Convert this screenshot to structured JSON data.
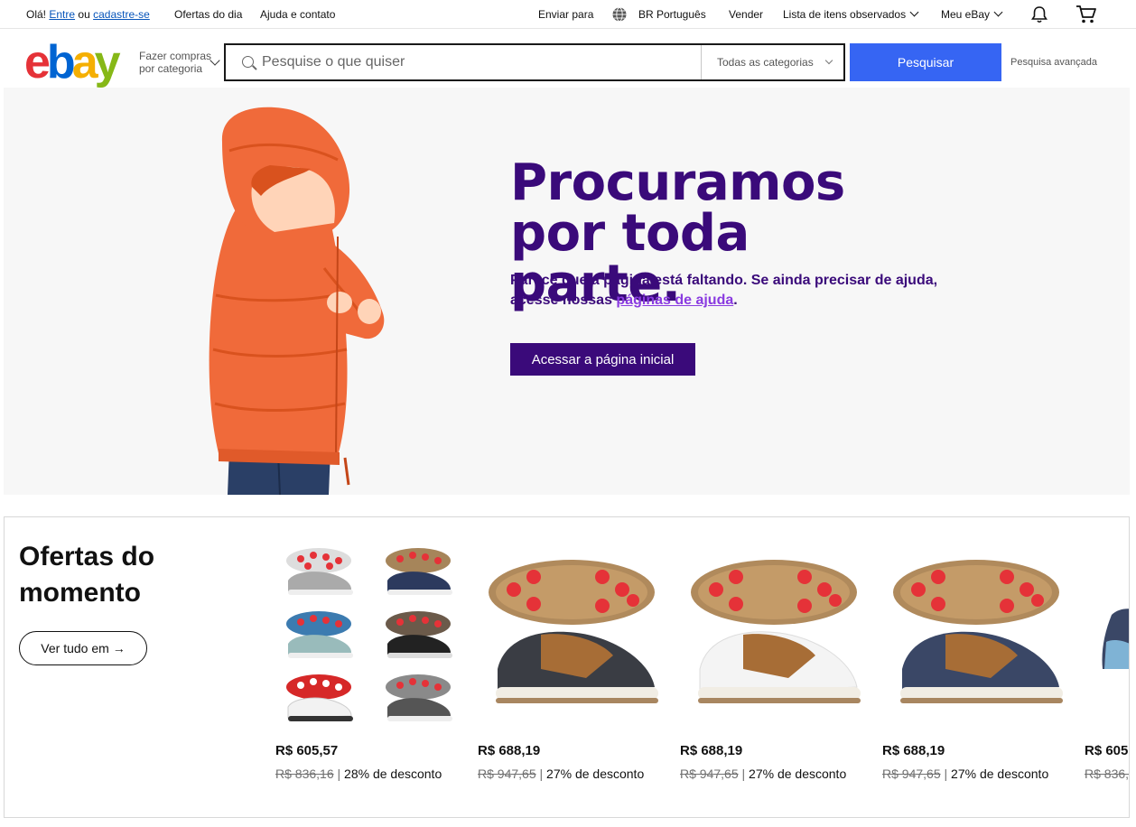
{
  "topbar": {
    "greeting": "Olá!",
    "signin": "Entre",
    "or": "ou",
    "register": "cadastre-se",
    "daily_deals": "Ofertas do dia",
    "help": "Ajuda e contato",
    "ship_to": "Enviar para",
    "language": "BR Português",
    "sell": "Vender",
    "watchlist": "Lista de itens observados",
    "my_ebay": "Meu eBay"
  },
  "header": {
    "logo": {
      "e": "e",
      "b": "b",
      "a": "a",
      "y": "y"
    },
    "shop_by_category": "Fazer compras por categoria",
    "search_placeholder": "Pesquise o que quiser",
    "category_select": "Todas as categorias",
    "search_button": "Pesquisar",
    "advanced": "Pesquisa avançada"
  },
  "hero": {
    "title": "Procuramos por toda parte.",
    "message_pre": "Parece que a página está faltando. Se ainda precisar de ajuda, acesse nossas ",
    "message_link": "páginas de ajuda",
    "message_post": ".",
    "home_button": "Acessar a página inicial"
  },
  "deals": {
    "title": "Ofertas do momento",
    "see_all": "Ver tudo em",
    "items": [
      {
        "price": "R$ 605,57",
        "original": "R$ 836,16",
        "discount": "28% de desconto"
      },
      {
        "price": "R$ 688,19",
        "original": "R$ 947,65",
        "discount": "27% de desconto"
      },
      {
        "price": "R$ 688,19",
        "original": "R$ 947,65",
        "discount": "27% de desconto"
      },
      {
        "price": "R$ 688,19",
        "original": "R$ 947,65",
        "discount": "27% de desconto"
      },
      {
        "price": "R$ 605",
        "original": "R$ 836,",
        "discount": ""
      }
    ]
  },
  "colors": {
    "accent": "#3665f3",
    "hero_text": "#3a0a7a",
    "link_purple": "#8a3be0",
    "jacket": "#f06a3a"
  }
}
